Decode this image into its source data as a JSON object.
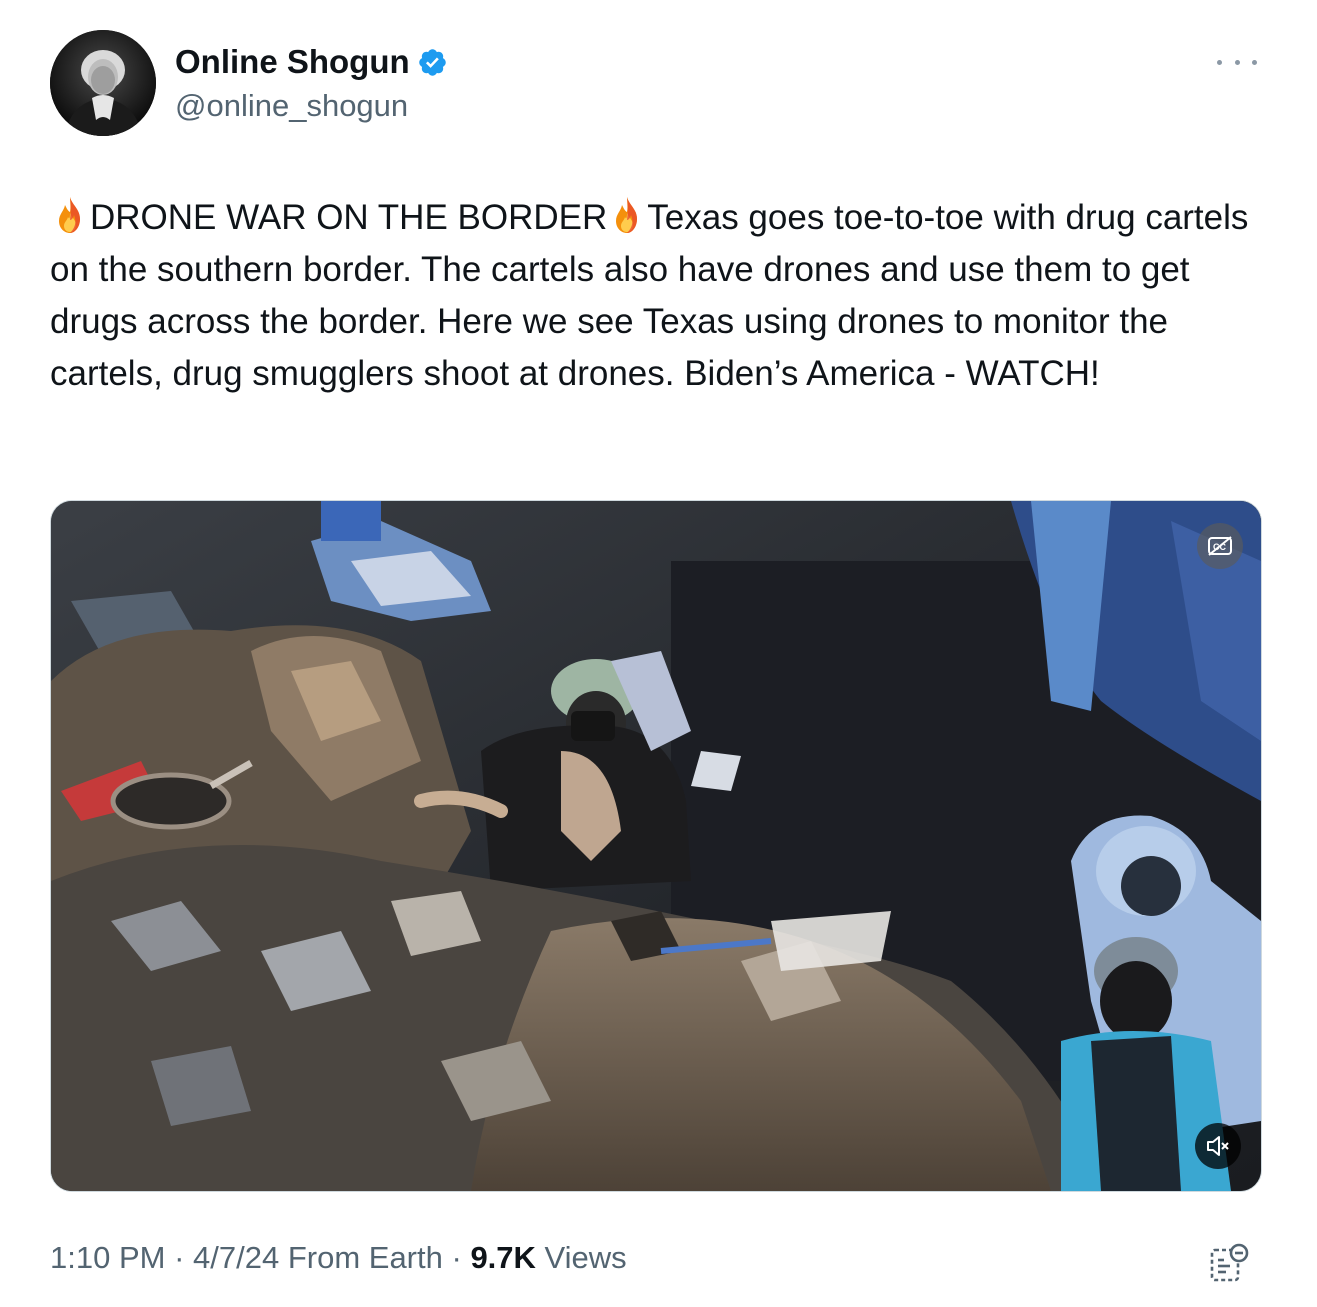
{
  "author": {
    "display_name": "Online Shogun",
    "handle": "@online_shogun",
    "verified": true,
    "verified_color": "#1d9bf0"
  },
  "tweet": {
    "emoji": "🔥",
    "headline": "DRONE WAR ON THE BORDER",
    "body": "Texas goes toe-to-toe with drug cartels on the southern border. The cartels also have drones and use them to get drugs across the border. Here we see Texas using drones to monitor the cartels, drug smugglers shoot at drones. Biden’s America - WATCH!"
  },
  "media": {
    "type": "video",
    "captions_icon": "captions-off-icon",
    "mute_icon": "speaker-muted-icon"
  },
  "meta": {
    "time": "1:10 PM",
    "separator": " · ",
    "date": "4/7/24",
    "source": " From Earth",
    "views_count": "9.7K",
    "views_label": " Views"
  },
  "icons": {
    "more": "more-options-icon",
    "analytics": "post-analytics-icon"
  }
}
